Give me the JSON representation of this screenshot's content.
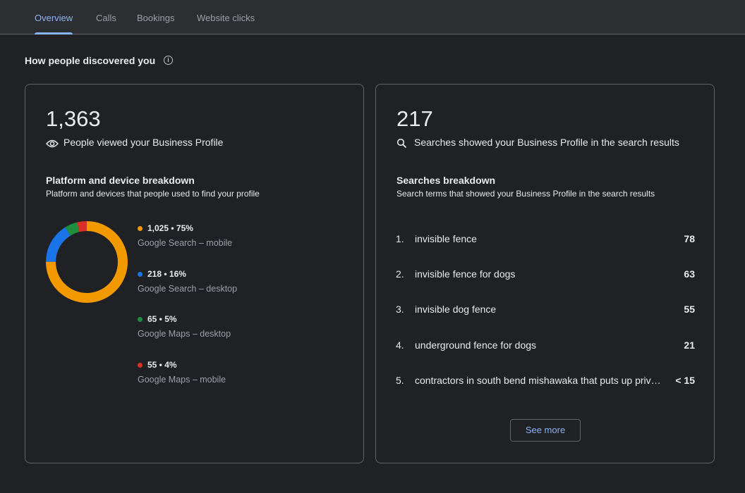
{
  "tabs": [
    {
      "label": "Overview",
      "active": true
    },
    {
      "label": "Calls"
    },
    {
      "label": "Bookings"
    },
    {
      "label": "Website clicks"
    }
  ],
  "section_title": "How people discovered you",
  "left_card": {
    "value": "1,363",
    "label": "People viewed your Business Profile",
    "icon": "eye-icon",
    "breakdown_title": "Platform and device breakdown",
    "breakdown_subtitle": "Platform and devices that people used to find your profile",
    "items": [
      {
        "value_text": "1,025 • 75%",
        "label": "Google Search – mobile",
        "color": "#f29900",
        "percent": 75
      },
      {
        "value_text": "218 • 16%",
        "label": "Google Search – desktop",
        "color": "#1a73e8",
        "percent": 16
      },
      {
        "value_text": "65 • 5%",
        "label": "Google Maps – desktop",
        "color": "#1e8e3e",
        "percent": 5
      },
      {
        "value_text": "55 • 4%",
        "label": "Google Maps – mobile",
        "color": "#d93025",
        "percent": 4
      }
    ]
  },
  "right_card": {
    "value": "217",
    "label": "Searches showed your Business Profile in the search results",
    "icon": "search-icon",
    "breakdown_title": "Searches breakdown",
    "breakdown_subtitle": "Search terms that showed your Business Profile in the search results",
    "searches": [
      {
        "rank": "1.",
        "term": "invisible fence",
        "count": "78"
      },
      {
        "rank": "2.",
        "term": "invisible fence for dogs",
        "count": "63"
      },
      {
        "rank": "3.",
        "term": "invisible dog fence",
        "count": "55"
      },
      {
        "rank": "4.",
        "term": "underground fence for dogs",
        "count": "21"
      },
      {
        "rank": "5.",
        "term": "contractors in south bend mishawaka that puts up privacy fence",
        "count": "< 15"
      }
    ],
    "see_more_label": "See more"
  }
}
